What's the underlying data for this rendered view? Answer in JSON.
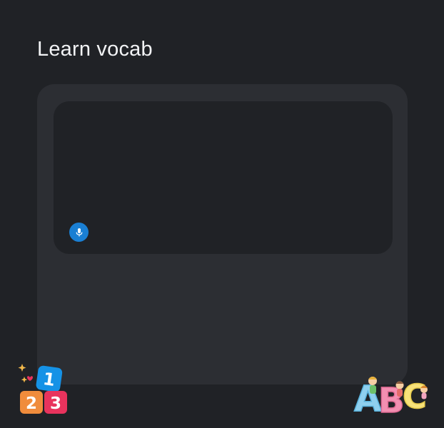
{
  "page": {
    "title": "Learn vocab"
  },
  "input": {
    "mic_icon": "microphone-icon"
  },
  "logos": {
    "numbers": {
      "name": "numbers-123-logo",
      "digits": [
        "1",
        "2",
        "3"
      ]
    },
    "letters": {
      "name": "abc-letters-logo",
      "letters": [
        "A",
        "B",
        "C"
      ]
    }
  },
  "colors": {
    "background": "#202226",
    "card": "#2c2e33",
    "accent": "#1a7fd3",
    "text": "#f2f3f5"
  }
}
